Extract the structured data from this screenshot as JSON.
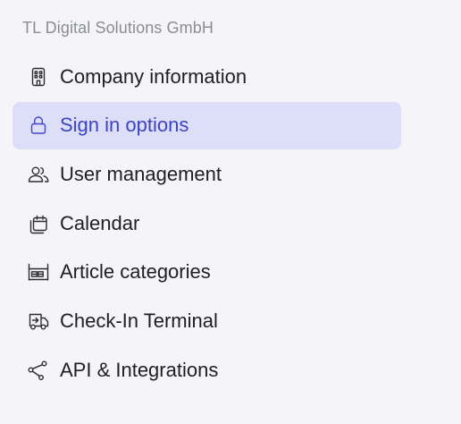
{
  "sidebar": {
    "section_title": "TL Digital Solutions GmbH",
    "items": [
      {
        "label": "Company information",
        "icon": "building-icon",
        "active": false
      },
      {
        "label": "Sign in options",
        "icon": "lock-icon",
        "active": true
      },
      {
        "label": "User management",
        "icon": "users-icon",
        "active": false
      },
      {
        "label": "Calendar",
        "icon": "calendar-icon",
        "active": false
      },
      {
        "label": "Article categories",
        "icon": "shelf-icon",
        "active": false
      },
      {
        "label": "Check-In Terminal",
        "icon": "truck-icon",
        "active": false
      },
      {
        "label": "API & Integrations",
        "icon": "share-icon",
        "active": false
      }
    ]
  },
  "colors": {
    "background": "#f5f5f7",
    "active_background": "#dddff8",
    "active_text": "#3d43c4",
    "text": "#1d1f24",
    "muted_text": "#8a8d94"
  }
}
